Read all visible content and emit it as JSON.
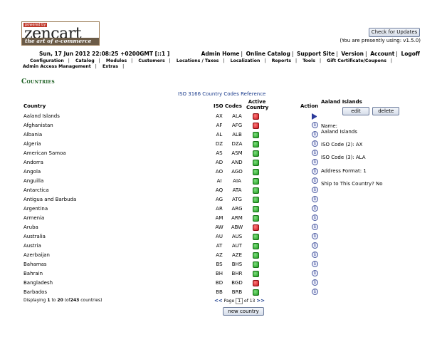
{
  "logo": {
    "powered_by": "powered by",
    "brand": "zencart",
    "tagline": "the art of e-commerce"
  },
  "header": {
    "update_button": "Check for Updates",
    "version_note": "(You are presently using: v1.5.0)",
    "datetime": "Sun, 17 Jun 2012 22:08:25 +0200GMT [::1 ]",
    "admin_links": [
      "Admin Home",
      "Online Catalog",
      "Support Site",
      "Version",
      "Account",
      "Logoff"
    ]
  },
  "menu": [
    "Configuration",
    "Catalog",
    "Modules",
    "Customers",
    "Locations / Taxes",
    "Localization",
    "Reports",
    "Tools",
    "Gift Certificate/Coupons",
    "Admin Access Management",
    "Extras"
  ],
  "page": {
    "title": "Countries",
    "iso_link": "ISO 3166 Country Codes Reference"
  },
  "table": {
    "headers": {
      "country": "Country",
      "iso": "ISO Codes",
      "active": "Active Country",
      "action": "Action"
    },
    "rows": [
      {
        "name": "Aaland Islands",
        "iso2": "AX",
        "iso3": "ALA",
        "active": false,
        "selected": true
      },
      {
        "name": "Afghanistan",
        "iso2": "AF",
        "iso3": "AFG",
        "active": false,
        "selected": false
      },
      {
        "name": "Albania",
        "iso2": "AL",
        "iso3": "ALB",
        "active": true,
        "selected": false
      },
      {
        "name": "Algeria",
        "iso2": "DZ",
        "iso3": "DZA",
        "active": true,
        "selected": false
      },
      {
        "name": "American Samoa",
        "iso2": "AS",
        "iso3": "ASM",
        "active": true,
        "selected": false
      },
      {
        "name": "Andorra",
        "iso2": "AD",
        "iso3": "AND",
        "active": true,
        "selected": false
      },
      {
        "name": "Angola",
        "iso2": "AO",
        "iso3": "AGO",
        "active": true,
        "selected": false
      },
      {
        "name": "Anguilla",
        "iso2": "AI",
        "iso3": "AIA",
        "active": true,
        "selected": false
      },
      {
        "name": "Antarctica",
        "iso2": "AQ",
        "iso3": "ATA",
        "active": true,
        "selected": false
      },
      {
        "name": "Antigua and Barbuda",
        "iso2": "AG",
        "iso3": "ATG",
        "active": true,
        "selected": false
      },
      {
        "name": "Argentina",
        "iso2": "AR",
        "iso3": "ARG",
        "active": true,
        "selected": false
      },
      {
        "name": "Armenia",
        "iso2": "AM",
        "iso3": "ARM",
        "active": true,
        "selected": false
      },
      {
        "name": "Aruba",
        "iso2": "AW",
        "iso3": "ABW",
        "active": false,
        "selected": false
      },
      {
        "name": "Australia",
        "iso2": "AU",
        "iso3": "AUS",
        "active": true,
        "selected": false
      },
      {
        "name": "Austria",
        "iso2": "AT",
        "iso3": "AUT",
        "active": true,
        "selected": false
      },
      {
        "name": "Azerbaijan",
        "iso2": "AZ",
        "iso3": "AZE",
        "active": true,
        "selected": false
      },
      {
        "name": "Bahamas",
        "iso2": "BS",
        "iso3": "BHS",
        "active": true,
        "selected": false
      },
      {
        "name": "Bahrain",
        "iso2": "BH",
        "iso3": "BHR",
        "active": true,
        "selected": false
      },
      {
        "name": "Bangladesh",
        "iso2": "BD",
        "iso3": "BGD",
        "active": false,
        "selected": false
      },
      {
        "name": "Barbados",
        "iso2": "BB",
        "iso3": "BRB",
        "active": true,
        "selected": false
      }
    ]
  },
  "pagination": {
    "display_prefix": "Displaying",
    "from": "1",
    "to_word": "to",
    "to": "20",
    "of_prefix": "(of",
    "total": "243",
    "of_suffix": "countries)",
    "prev": "<<",
    "page_label": "Page",
    "current_page": "1",
    "of_pages": "of 13",
    "next": ">>"
  },
  "new_button": "new country",
  "infobox": {
    "title": "Aaland Islands",
    "edit": "edit",
    "delete": "delete",
    "name_label": "Name:",
    "name_value": "Aaland Islands",
    "iso2": "ISO Code (2): AX",
    "iso3": "ISO Code (3): ALA",
    "address_format": "Address Format: 1",
    "ship": "Ship to This Country? No"
  }
}
